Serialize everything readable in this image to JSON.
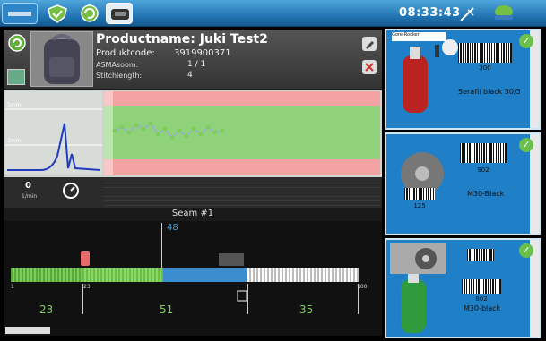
{
  "topbar": {
    "clock": "08:33:43"
  },
  "product": {
    "name_label": "Productname:",
    "name_value": "Juki Test2",
    "code_label": "Produktcode:",
    "code_value": "3919900371",
    "asm_label": "ASMAsoom:",
    "asm_value": "1 / 1",
    "stitch_label": "Stitchlength:",
    "stitch_value": "4"
  },
  "curve": {
    "label_top": "5mm",
    "label_mid": "3mm"
  },
  "counter": {
    "value": "0",
    "unit": "1/min"
  },
  "seam": {
    "title": "Seam #1",
    "position": "48",
    "start_tick": "1",
    "tick_23": "23",
    "tick_100": "100",
    "segments": [
      "23",
      "51",
      "35"
    ]
  },
  "cards": [
    {
      "barcode_text": "300",
      "label": "Serafil black 30/3",
      "small_label": "Gore-Rocker"
    },
    {
      "barcode_text": "902",
      "label": "M30-Black",
      "spool_code": "125"
    },
    {
      "barcode_text": "802",
      "label": "M30-black"
    }
  ],
  "colors": {
    "accent": "#1f7fc7",
    "check": "#6ac04a",
    "band_green": "#8fd27a",
    "band_red": "#f4a3a3"
  }
}
